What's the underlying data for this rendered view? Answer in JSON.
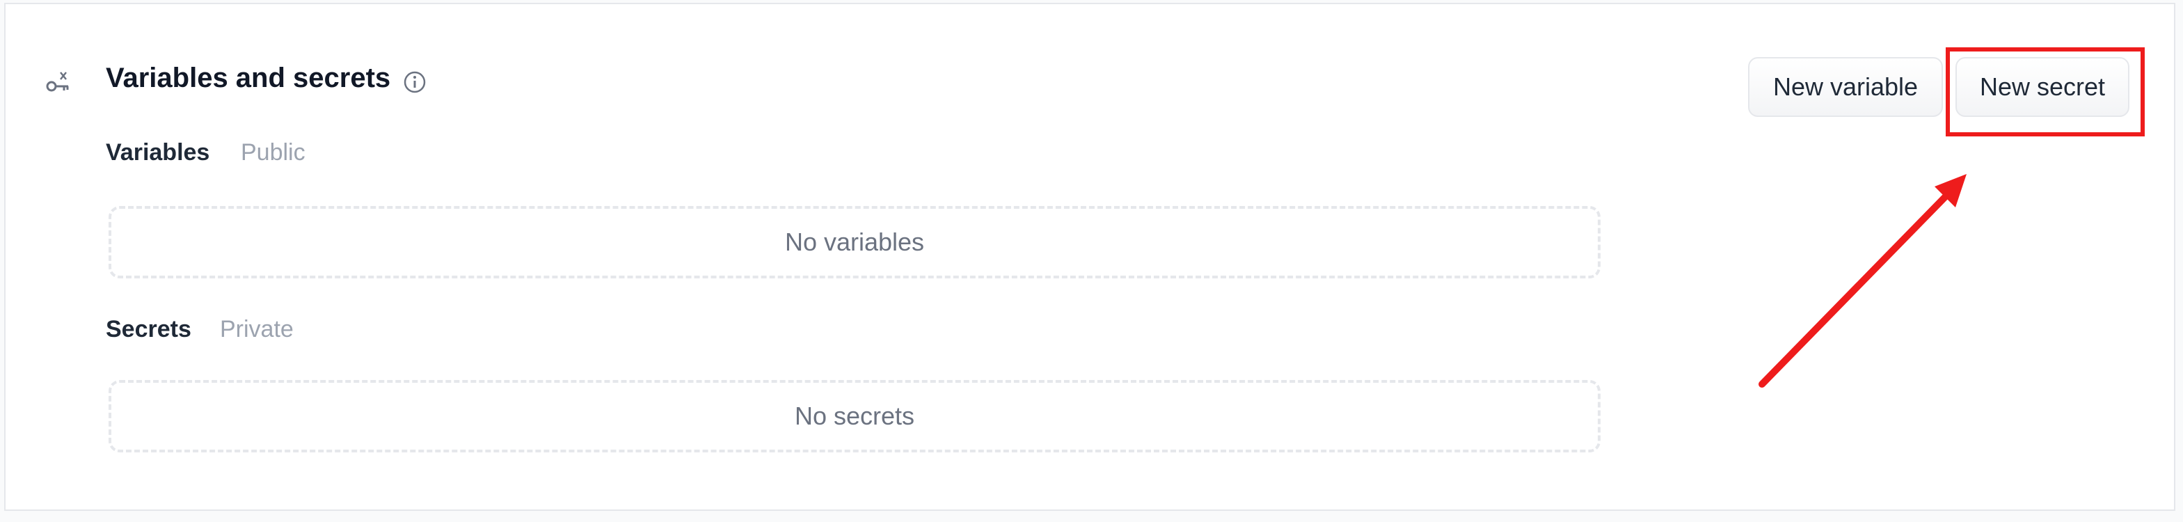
{
  "section": {
    "title": "Variables and secrets",
    "icon": "key-variable-icon",
    "info_icon": "info-icon"
  },
  "variables": {
    "label": "Variables",
    "hint": "Public",
    "empty_text": "No variables"
  },
  "secrets": {
    "label": "Secrets",
    "hint": "Private",
    "empty_text": "No secrets"
  },
  "actions": {
    "new_variable_label": "New variable",
    "new_secret_label": "New secret"
  },
  "annotation": {
    "highlight_color": "#ee1c1c",
    "highlighted_target": "new-secret-button"
  },
  "colors": {
    "text_primary": "#111827",
    "text_muted": "#9ca3af",
    "border": "#e5e7eb"
  }
}
